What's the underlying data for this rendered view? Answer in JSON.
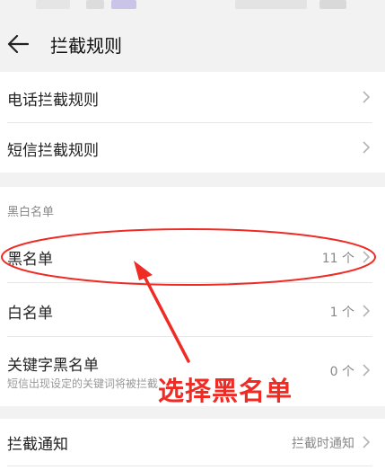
{
  "header": {
    "title": "拦截规则",
    "back_icon": "arrow-left-icon"
  },
  "rules": [
    {
      "label": "电话拦截规则"
    },
    {
      "label": "短信拦截规则"
    }
  ],
  "lists": {
    "section_title": "黑白名单",
    "items": [
      {
        "label": "黑名单",
        "value": "11 个"
      },
      {
        "label": "白名单",
        "value": "1 个"
      },
      {
        "label": "关键字黑名单",
        "sub": "短信出现设定的关键词将被拦截",
        "value": "0 个"
      }
    ]
  },
  "notify": {
    "label": "拦截通知",
    "value": "拦截时通知"
  },
  "annotation": {
    "text": "选择黑名单",
    "color": "#ef2b24"
  },
  "colors": {
    "background": "#f2f2f2",
    "card": "#ffffff"
  }
}
